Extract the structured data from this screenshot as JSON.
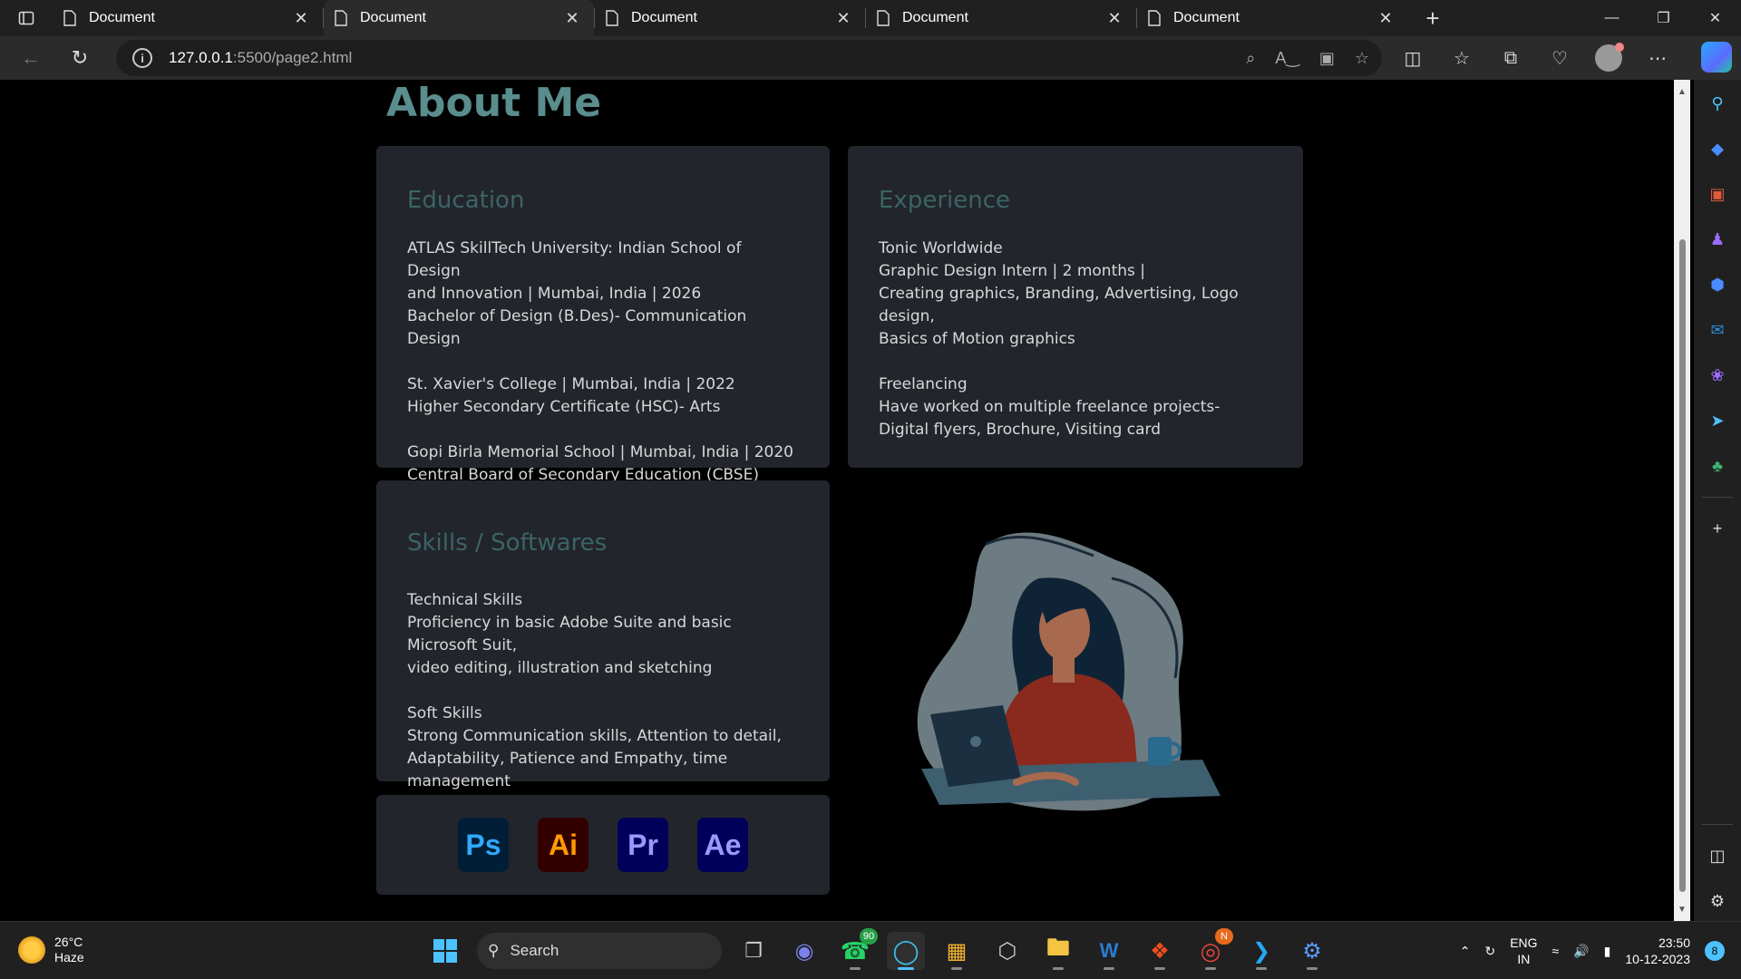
{
  "browser": {
    "tabs": [
      {
        "label": "Document",
        "active": false
      },
      {
        "label": "Document",
        "active": true
      },
      {
        "label": "Document",
        "active": false
      },
      {
        "label": "Document",
        "active": false
      },
      {
        "label": "Document",
        "active": false
      }
    ],
    "url_host": "127.0.0.1",
    "url_rest": ":5500/page2.html"
  },
  "page": {
    "title": "About Me",
    "education": {
      "heading": "Education",
      "entries": [
        [
          "ATLAS SkillTech University: Indian School of Design",
          "and Innovation | Mumbai, India | 2026",
          "Bachelor of Design (B.Des)- Communication Design"
        ],
        [
          "St. Xavier's College | Mumbai, India | 2022",
          "Higher Secondary Certificate (HSC)- Arts"
        ],
        [
          "Gopi Birla Memorial School | Mumbai, India | 2020",
          "Central Board of Secondary Education (CBSE)"
        ]
      ]
    },
    "experience": {
      "heading": "Experience",
      "entries": [
        [
          "Tonic Worldwide",
          "Graphic Design Intern | 2 months |",
          "Creating graphics, Branding, Advertising, Logo design,",
          "Basics of Motion graphics"
        ],
        [
          "Freelancing",
          "Have worked on multiple freelance projects-",
          "Digital flyers, Brochure, Visiting card"
        ]
      ]
    },
    "skills": {
      "heading": "Skills / Softwares",
      "entries": [
        [
          "Technical Skills",
          "Proficiency in basic Adobe Suite and basic Microsoft Suit,",
          "video editing, illustration and sketching"
        ],
        [
          "Soft Skills",
          "Strong Communication skills, Attention to detail,",
          "Adaptability, Patience and Empathy, time management"
        ]
      ]
    },
    "apps": [
      "Ps",
      "Ai",
      "Pr",
      "Ae"
    ]
  },
  "taskbar": {
    "weather_temp": "26°C",
    "weather_desc": "Haze",
    "search_label": "Search",
    "whatsapp_badge": "90",
    "chrome_badge": "N",
    "lang_line1": "ENG",
    "lang_line2": "IN",
    "time": "23:50",
    "date": "10-12-2023",
    "notifications": "8"
  },
  "colors": {
    "title": "#5a8d8d",
    "card_heading": "#3c6464",
    "card_bg": "#22252b",
    "accent": "#4cc2ff"
  }
}
